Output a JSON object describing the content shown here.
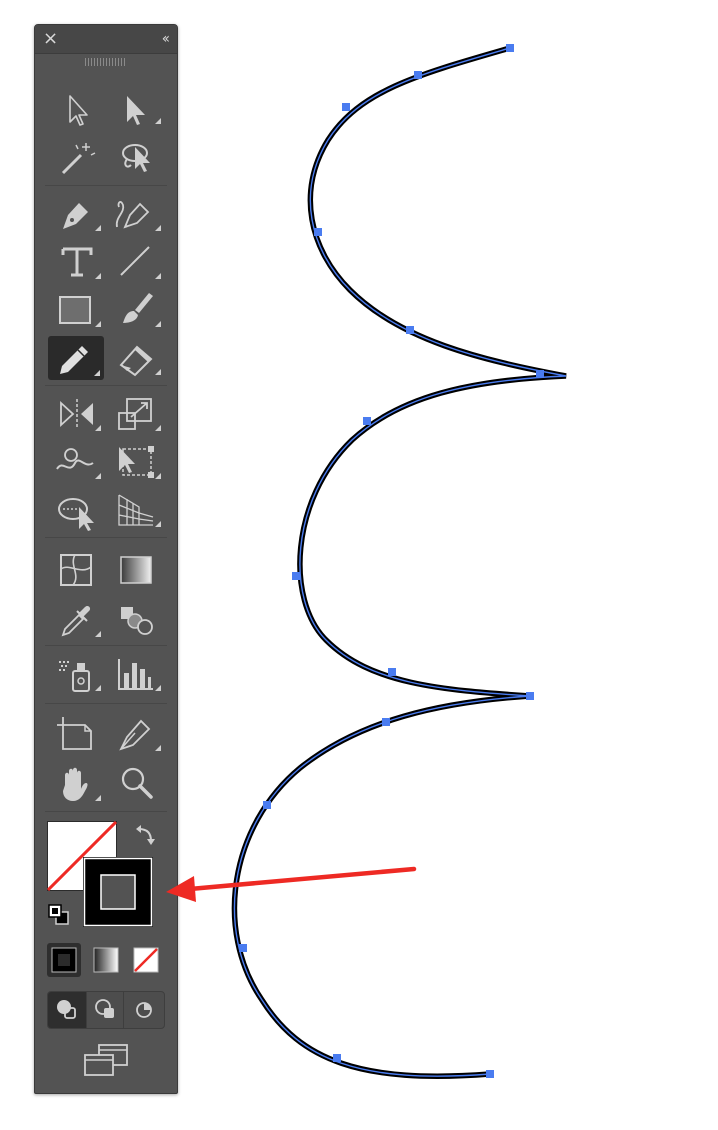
{
  "toolbar": {
    "close_glyph": "×",
    "collapse_glyph": "‹‹",
    "tools": [
      {
        "id": "selection",
        "icon": "selection-arrow-icon"
      },
      {
        "id": "direct-selection",
        "icon": "direct-selection-arrow-icon"
      },
      {
        "id": "magic-wand",
        "icon": "magic-wand-icon"
      },
      {
        "id": "lasso",
        "icon": "lasso-icon"
      },
      {
        "id": "pen",
        "icon": "pen-icon"
      },
      {
        "id": "curvature",
        "icon": "curvature-pen-icon"
      },
      {
        "id": "type",
        "icon": "type-icon"
      },
      {
        "id": "line-segment",
        "icon": "line-segment-icon"
      },
      {
        "id": "rectangle",
        "icon": "rectangle-icon"
      },
      {
        "id": "paintbrush",
        "icon": "paintbrush-icon"
      },
      {
        "id": "pencil",
        "icon": "pencil-icon",
        "active": true
      },
      {
        "id": "eraser",
        "icon": "eraser-icon"
      },
      {
        "id": "reflect",
        "icon": "reflect-icon"
      },
      {
        "id": "scale",
        "icon": "scale-icon"
      },
      {
        "id": "warp",
        "icon": "warp-icon"
      },
      {
        "id": "free-transform",
        "icon": "free-transform-icon"
      },
      {
        "id": "shape-builder",
        "icon": "shape-builder-icon"
      },
      {
        "id": "perspective-grid",
        "icon": "perspective-grid-icon"
      },
      {
        "id": "mesh",
        "icon": "mesh-icon"
      },
      {
        "id": "gradient",
        "icon": "gradient-icon"
      },
      {
        "id": "eyedropper",
        "icon": "eyedropper-icon"
      },
      {
        "id": "blend",
        "icon": "blend-icon"
      },
      {
        "id": "symbol-sprayer",
        "icon": "symbol-sprayer-icon"
      },
      {
        "id": "column-graph",
        "icon": "column-graph-icon"
      },
      {
        "id": "artboard",
        "icon": "artboard-icon"
      },
      {
        "id": "slice",
        "icon": "slice-icon"
      },
      {
        "id": "hand",
        "icon": "hand-icon"
      },
      {
        "id": "zoom",
        "icon": "zoom-icon"
      }
    ],
    "fill_stroke": {
      "fill": "none",
      "stroke": "#000000",
      "swap_icon": "swap-arrow-icon",
      "default_icon": "default-fill-stroke-icon"
    },
    "color_modes": [
      "color-mode-icon",
      "gradient-mode-icon",
      "none-mode-icon"
    ],
    "draw_modes": [
      "draw-normal-icon",
      "draw-behind-icon",
      "draw-inside-icon"
    ],
    "screen_mode_icon": "screen-mode-icon"
  },
  "colors": {
    "panel": "#535353",
    "icon": "#d0d0d0",
    "path_stroke": "#000000",
    "path_highlight": "#4a7cf0",
    "anchor": "#4a7cf0",
    "annotation_arrow": "#ee2a24"
  },
  "canvas": {
    "path_icon": "pencil-drawn-path",
    "annotation_icon": "red-arrow-icon"
  }
}
